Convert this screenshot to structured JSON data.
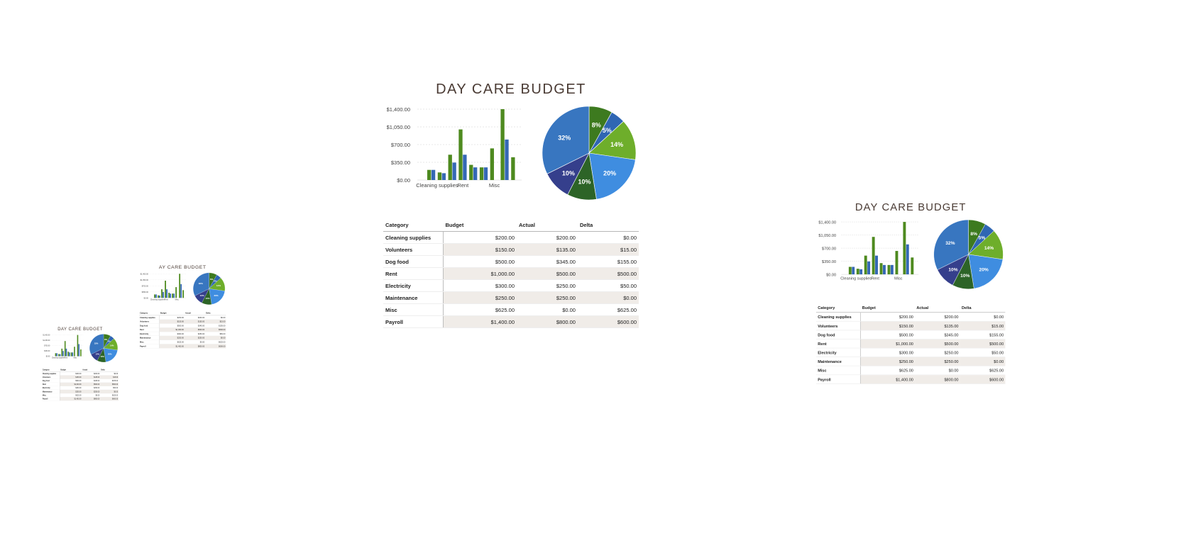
{
  "sheet": {
    "title": "DAY CARE BUDGET",
    "cropped_title": "AY CARE BUDGET",
    "table": {
      "headers": [
        "Category",
        "Budget",
        "Actual",
        "Delta"
      ],
      "rows": [
        {
          "category": "Cleaning supplies",
          "budget": "$200.00",
          "actual": "$200.00",
          "delta": "$0.00"
        },
        {
          "category": "Volunteers",
          "budget": "$150.00",
          "actual": "$135.00",
          "delta": "$15.00"
        },
        {
          "category": "Dog food",
          "budget": "$500.00",
          "actual": "$345.00",
          "delta": "$155.00"
        },
        {
          "category": "Rent",
          "budget": "$1,000.00",
          "actual": "$500.00",
          "delta": "$500.00"
        },
        {
          "category": "Electricity",
          "budget": "$300.00",
          "actual": "$250.00",
          "delta": "$50.00"
        },
        {
          "category": "Maintenance",
          "budget": "$250.00",
          "actual": "$250.00",
          "delta": "$0.00"
        },
        {
          "category": "Misc",
          "budget": "$625.00",
          "actual": "$0.00",
          "delta": "$625.00"
        },
        {
          "category": "Payroll",
          "budget": "$1,400.00",
          "actual": "$800.00",
          "delta": "$600.00"
        }
      ]
    }
  },
  "colors": {
    "budget": "#4e8a1f",
    "actual": "#3568b5",
    "title": "#4a3b34",
    "pie": [
      "#3d7a1f",
      "#2f66b3",
      "#6eae2b",
      "#3f8de0",
      "#2d6427",
      "#353f8c",
      "#3876c0"
    ]
  },
  "chart_data": [
    {
      "type": "bar",
      "categories": [
        "Cleaning supplies",
        "Volunteers",
        "Dog food",
        "Rent",
        "Electricity",
        "Maintenance",
        "Misc",
        "Payroll"
      ],
      "visible_category_labels": [
        "Cleaning supplies",
        "Rent",
        "Misc"
      ],
      "series": [
        {
          "values": [
            200,
            150,
            500,
            1000,
            300,
            250,
            625,
            1400
          ]
        },
        {
          "values": [
            200,
            135,
            345,
            500,
            250,
            250,
            0,
            800
          ]
        }
      ],
      "y_ticks": [
        "$0.00",
        "$350.00",
        "$700.00",
        "$1,050.00",
        "$1,400.00"
      ],
      "ylim": [
        0,
        1400
      ],
      "grid": true,
      "extra_bars": [
        450
      ]
    },
    {
      "type": "pie",
      "labels": [
        "8%",
        "5%",
        "14%",
        "20%",
        "10%",
        "10%",
        "32%"
      ],
      "values": [
        8,
        5,
        14,
        20,
        10,
        10,
        32
      ]
    }
  ]
}
